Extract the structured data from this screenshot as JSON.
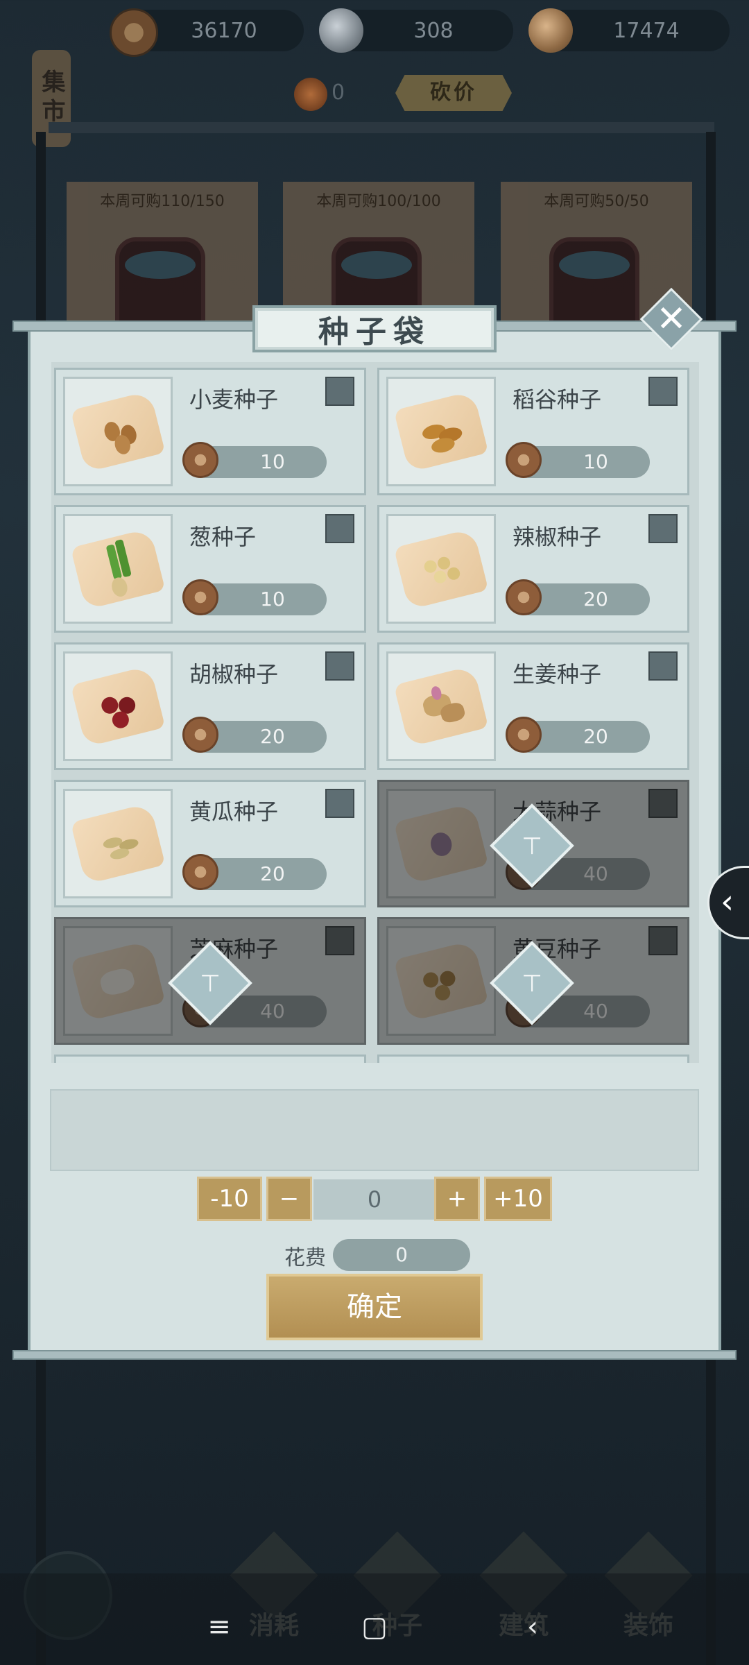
{
  "topbar": {
    "currencies": [
      {
        "icon": "copper-coin-icon",
        "value": "36170"
      },
      {
        "icon": "silver-ingot-icon",
        "value": "308"
      },
      {
        "icon": "shell-icon",
        "value": "17474"
      }
    ]
  },
  "market": {
    "tag": "集市",
    "token_value": "0",
    "bargain_label": "砍价",
    "stalls": [
      "本周可购110/150",
      "本周可购100/100",
      "本周可购50/50"
    ]
  },
  "dialog": {
    "title": "种子袋",
    "close_icon": "✕",
    "items": [
      {
        "name": "小麦种子",
        "price": "10",
        "locked": false
      },
      {
        "name": "稻谷种子",
        "price": "10",
        "locked": false
      },
      {
        "name": "葱种子",
        "price": "10",
        "locked": false
      },
      {
        "name": "辣椒种子",
        "price": "20",
        "locked": false
      },
      {
        "name": "胡椒种子",
        "price": "20",
        "locked": false
      },
      {
        "name": "生姜种子",
        "price": "20",
        "locked": false
      },
      {
        "name": "黄瓜种子",
        "price": "20",
        "locked": false
      },
      {
        "name": "大蒜种子",
        "price": "40",
        "locked": true
      },
      {
        "name": "芝麻种子",
        "price": "40",
        "locked": true
      },
      {
        "name": "黄豆种子",
        "price": "40",
        "locked": true
      }
    ],
    "quantity": {
      "minus10": "-10",
      "minus": "−",
      "value": "0",
      "plus": "+",
      "plus10": "+10"
    },
    "cost_label": "花费",
    "cost_value": "0",
    "confirm_label": "确定"
  },
  "side_tab_icon": "‹",
  "dock": {
    "items": [
      "消耗",
      "种子",
      "建筑",
      "装饰"
    ]
  },
  "navbar": {
    "menu_icon": "≡",
    "home_icon": "▢",
    "back_icon": "‹"
  },
  "colors": {
    "dialog_bg": "#d6e2e2",
    "pill": "#8fa2a3",
    "gold_button": "#b89a5e"
  }
}
